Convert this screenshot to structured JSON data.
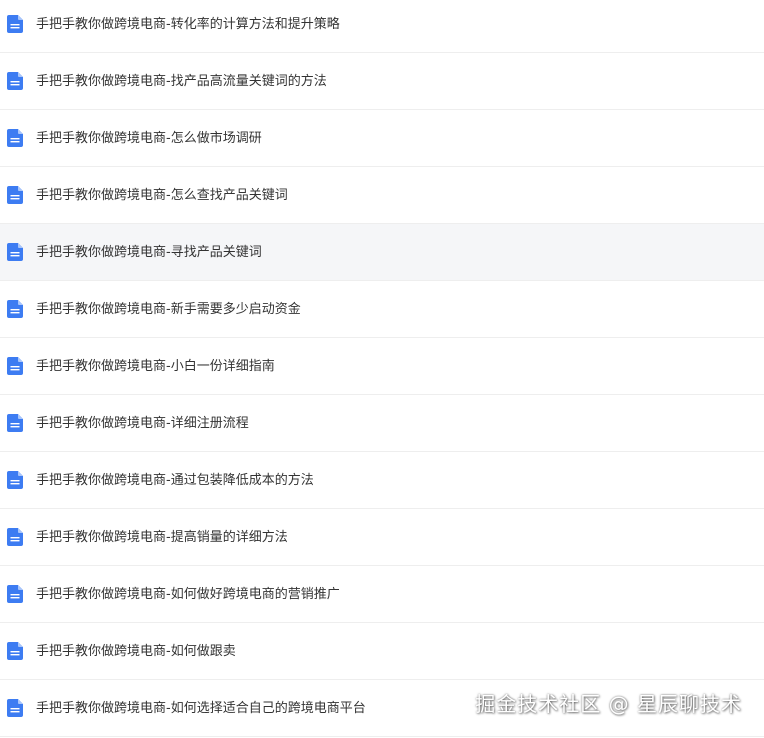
{
  "colors": {
    "doc_icon": "#3d7cf2",
    "hover_row": "#f5f6f8",
    "title_text": "#333333",
    "divider": "#eeeeee"
  },
  "files": [
    {
      "title": "手把手教你做跨境电商-转化率的计算方法和提升策略",
      "icon": "document-icon"
    },
    {
      "title": "手把手教你做跨境电商-找产品高流量关键词的方法",
      "icon": "document-icon"
    },
    {
      "title": "手把手教你做跨境电商-怎么做市场调研",
      "icon": "document-icon"
    },
    {
      "title": "手把手教你做跨境电商-怎么查找产品关键词",
      "icon": "document-icon"
    },
    {
      "title": "手把手教你做跨境电商-寻找产品关键词",
      "icon": "document-icon",
      "hovered": true
    },
    {
      "title": "手把手教你做跨境电商-新手需要多少启动资金",
      "icon": "document-icon"
    },
    {
      "title": "手把手教你做跨境电商-小白一份详细指南",
      "icon": "document-icon"
    },
    {
      "title": "手把手教你做跨境电商-详细注册流程",
      "icon": "document-icon"
    },
    {
      "title": "手把手教你做跨境电商-通过包装降低成本的方法",
      "icon": "document-icon"
    },
    {
      "title": "手把手教你做跨境电商-提高销量的详细方法",
      "icon": "document-icon"
    },
    {
      "title": "手把手教你做跨境电商-如何做好跨境电商的营销推广",
      "icon": "document-icon"
    },
    {
      "title": "手把手教你做跨境电商-如何做跟卖",
      "icon": "document-icon"
    },
    {
      "title": "手把手教你做跨境电商-如何选择适合自己的跨境电商平台",
      "icon": "document-icon"
    }
  ],
  "watermark": "掘金技术社区 @ 星辰聊技术"
}
